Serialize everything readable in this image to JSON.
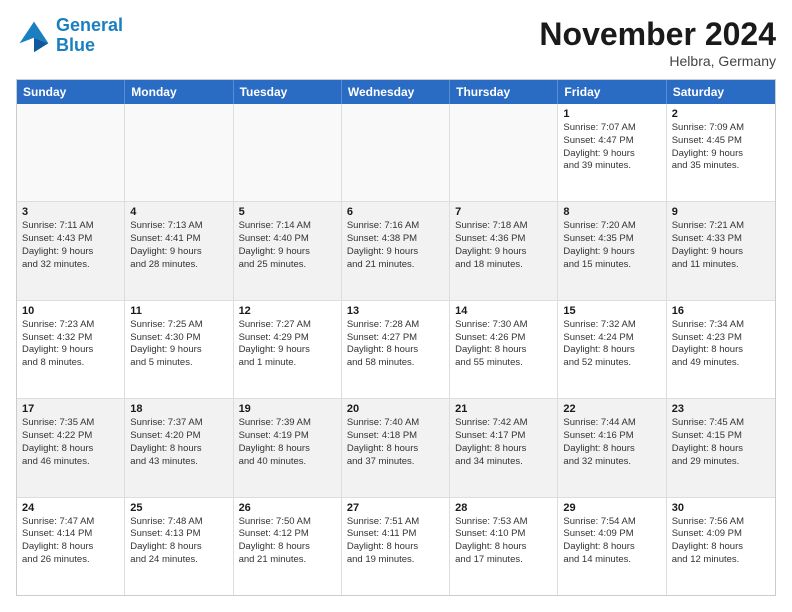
{
  "header": {
    "logo_line1": "General",
    "logo_line2": "Blue",
    "month_title": "November 2024",
    "location": "Helbra, Germany"
  },
  "weekdays": [
    "Sunday",
    "Monday",
    "Tuesday",
    "Wednesday",
    "Thursday",
    "Friday",
    "Saturday"
  ],
  "rows": [
    [
      {
        "day": "",
        "info": ""
      },
      {
        "day": "",
        "info": ""
      },
      {
        "day": "",
        "info": ""
      },
      {
        "day": "",
        "info": ""
      },
      {
        "day": "",
        "info": ""
      },
      {
        "day": "1",
        "info": "Sunrise: 7:07 AM\nSunset: 4:47 PM\nDaylight: 9 hours\nand 39 minutes."
      },
      {
        "day": "2",
        "info": "Sunrise: 7:09 AM\nSunset: 4:45 PM\nDaylight: 9 hours\nand 35 minutes."
      }
    ],
    [
      {
        "day": "3",
        "info": "Sunrise: 7:11 AM\nSunset: 4:43 PM\nDaylight: 9 hours\nand 32 minutes."
      },
      {
        "day": "4",
        "info": "Sunrise: 7:13 AM\nSunset: 4:41 PM\nDaylight: 9 hours\nand 28 minutes."
      },
      {
        "day": "5",
        "info": "Sunrise: 7:14 AM\nSunset: 4:40 PM\nDaylight: 9 hours\nand 25 minutes."
      },
      {
        "day": "6",
        "info": "Sunrise: 7:16 AM\nSunset: 4:38 PM\nDaylight: 9 hours\nand 21 minutes."
      },
      {
        "day": "7",
        "info": "Sunrise: 7:18 AM\nSunset: 4:36 PM\nDaylight: 9 hours\nand 18 minutes."
      },
      {
        "day": "8",
        "info": "Sunrise: 7:20 AM\nSunset: 4:35 PM\nDaylight: 9 hours\nand 15 minutes."
      },
      {
        "day": "9",
        "info": "Sunrise: 7:21 AM\nSunset: 4:33 PM\nDaylight: 9 hours\nand 11 minutes."
      }
    ],
    [
      {
        "day": "10",
        "info": "Sunrise: 7:23 AM\nSunset: 4:32 PM\nDaylight: 9 hours\nand 8 minutes."
      },
      {
        "day": "11",
        "info": "Sunrise: 7:25 AM\nSunset: 4:30 PM\nDaylight: 9 hours\nand 5 minutes."
      },
      {
        "day": "12",
        "info": "Sunrise: 7:27 AM\nSunset: 4:29 PM\nDaylight: 9 hours\nand 1 minute."
      },
      {
        "day": "13",
        "info": "Sunrise: 7:28 AM\nSunset: 4:27 PM\nDaylight: 8 hours\nand 58 minutes."
      },
      {
        "day": "14",
        "info": "Sunrise: 7:30 AM\nSunset: 4:26 PM\nDaylight: 8 hours\nand 55 minutes."
      },
      {
        "day": "15",
        "info": "Sunrise: 7:32 AM\nSunset: 4:24 PM\nDaylight: 8 hours\nand 52 minutes."
      },
      {
        "day": "16",
        "info": "Sunrise: 7:34 AM\nSunset: 4:23 PM\nDaylight: 8 hours\nand 49 minutes."
      }
    ],
    [
      {
        "day": "17",
        "info": "Sunrise: 7:35 AM\nSunset: 4:22 PM\nDaylight: 8 hours\nand 46 minutes."
      },
      {
        "day": "18",
        "info": "Sunrise: 7:37 AM\nSunset: 4:20 PM\nDaylight: 8 hours\nand 43 minutes."
      },
      {
        "day": "19",
        "info": "Sunrise: 7:39 AM\nSunset: 4:19 PM\nDaylight: 8 hours\nand 40 minutes."
      },
      {
        "day": "20",
        "info": "Sunrise: 7:40 AM\nSunset: 4:18 PM\nDaylight: 8 hours\nand 37 minutes."
      },
      {
        "day": "21",
        "info": "Sunrise: 7:42 AM\nSunset: 4:17 PM\nDaylight: 8 hours\nand 34 minutes."
      },
      {
        "day": "22",
        "info": "Sunrise: 7:44 AM\nSunset: 4:16 PM\nDaylight: 8 hours\nand 32 minutes."
      },
      {
        "day": "23",
        "info": "Sunrise: 7:45 AM\nSunset: 4:15 PM\nDaylight: 8 hours\nand 29 minutes."
      }
    ],
    [
      {
        "day": "24",
        "info": "Sunrise: 7:47 AM\nSunset: 4:14 PM\nDaylight: 8 hours\nand 26 minutes."
      },
      {
        "day": "25",
        "info": "Sunrise: 7:48 AM\nSunset: 4:13 PM\nDaylight: 8 hours\nand 24 minutes."
      },
      {
        "day": "26",
        "info": "Sunrise: 7:50 AM\nSunset: 4:12 PM\nDaylight: 8 hours\nand 21 minutes."
      },
      {
        "day": "27",
        "info": "Sunrise: 7:51 AM\nSunset: 4:11 PM\nDaylight: 8 hours\nand 19 minutes."
      },
      {
        "day": "28",
        "info": "Sunrise: 7:53 AM\nSunset: 4:10 PM\nDaylight: 8 hours\nand 17 minutes."
      },
      {
        "day": "29",
        "info": "Sunrise: 7:54 AM\nSunset: 4:09 PM\nDaylight: 8 hours\nand 14 minutes."
      },
      {
        "day": "30",
        "info": "Sunrise: 7:56 AM\nSunset: 4:09 PM\nDaylight: 8 hours\nand 12 minutes."
      }
    ]
  ]
}
